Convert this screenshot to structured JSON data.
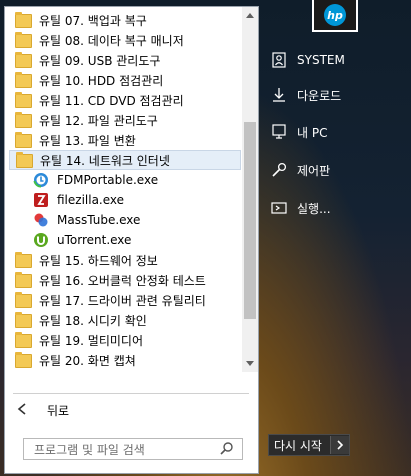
{
  "menu": {
    "items": [
      {
        "label": "유틸 07. 백업과 복구",
        "type": "folder"
      },
      {
        "label": "유틸 08. 데이타 복구 매니저",
        "type": "folder"
      },
      {
        "label": "유틸 09. USB 관리도구",
        "type": "folder"
      },
      {
        "label": "유틸 10. HDD 점검관리",
        "type": "folder"
      },
      {
        "label": "유틸 11. CD DVD 점검관리",
        "type": "folder"
      },
      {
        "label": "유틸 12. 파일 관리도구",
        "type": "folder"
      },
      {
        "label": "유틸 13. 파일 변환",
        "type": "folder"
      },
      {
        "label": "유틸 14. 네트워크 인터넷",
        "type": "folder",
        "highlighted": true
      },
      {
        "label": "FDMPortable.exe",
        "type": "app",
        "icon": "fdm-icon"
      },
      {
        "label": "filezilla.exe",
        "type": "app",
        "icon": "filezilla-icon"
      },
      {
        "label": "MassTube.exe",
        "type": "app",
        "icon": "masstube-icon"
      },
      {
        "label": "uTorrent.exe",
        "type": "app",
        "icon": "utorrent-icon"
      },
      {
        "label": "유틸 15. 하드웨어 정보",
        "type": "folder"
      },
      {
        "label": "유틸 16. 오버클럭 안정화 테스트",
        "type": "folder"
      },
      {
        "label": "유틸 17. 드라이버 관련 유틸리티",
        "type": "folder"
      },
      {
        "label": "유틸 18. 시디키 확인",
        "type": "folder"
      },
      {
        "label": "유틸 19. 멀티미디어",
        "type": "folder"
      },
      {
        "label": "유틸 20. 화면 캡쳐",
        "type": "folder"
      }
    ],
    "back_label": "뒤로",
    "search_placeholder": "프로그램 및 파일 검색"
  },
  "right": {
    "logo_text": "hp",
    "items": [
      {
        "label": "SYSTEM",
        "icon": "user-icon"
      },
      {
        "label": "다운로드",
        "icon": "download-icon"
      },
      {
        "label": "내 PC",
        "icon": "computer-icon"
      },
      {
        "label": "제어판",
        "icon": "wrench-icon"
      },
      {
        "label": "실행...",
        "icon": "run-icon"
      }
    ],
    "restart_label": "다시 시작"
  },
  "colors": {
    "highlight": "#e5eef8",
    "folder": "#f3c955",
    "panel_bg": "#ffffff"
  }
}
